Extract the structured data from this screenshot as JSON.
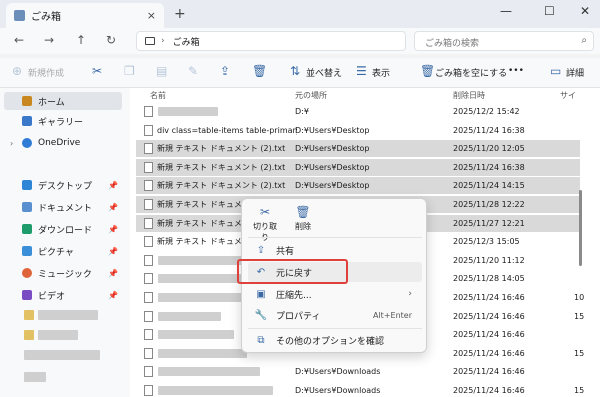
{
  "window": {
    "tab_title": "ごみ箱",
    "close_glyph": "×",
    "new_tab_glyph": "+",
    "minimize_glyph": "—",
    "maximize_glyph": "☐",
    "close_window_glyph": "✕"
  },
  "address": {
    "breadcrumb": "ごみ箱",
    "search_placeholder": "ごみ箱の検索"
  },
  "toolbar": {
    "new_label": "新規作成",
    "sort_label": "並べ替え",
    "view_label": "表示",
    "empty_recycle_label": "ごみ箱を空にする",
    "more_label": "•••",
    "details_label": "詳細"
  },
  "sidebar": {
    "items": [
      {
        "label": "ホーム",
        "icon": "home-icon"
      },
      {
        "label": "ギャラリー",
        "icon": "gallery-icon"
      },
      {
        "label": "OneDrive",
        "icon": "cloud-icon"
      },
      {
        "label": "デスクトップ",
        "icon": "desktop-icon"
      },
      {
        "label": "ドキュメント",
        "icon": "document-icon"
      },
      {
        "label": "ダウンロード",
        "icon": "download-icon"
      },
      {
        "label": "ピクチャ",
        "icon": "picture-icon"
      },
      {
        "label": "ミュージック",
        "icon": "music-icon"
      },
      {
        "label": "ビデオ",
        "icon": "video-icon"
      }
    ],
    "pin_glyph": "📌"
  },
  "columns": {
    "name": "名前",
    "location": "元の場所",
    "deleted_date": "削除日時",
    "size": "サイ"
  },
  "rows": [
    {
      "name": "",
      "location": "D:¥",
      "date": "2025/12/2 15:42",
      "selected": false
    },
    {
      "name": "div class=table-items table-primary...",
      "location": "D:¥Users¥Desktop",
      "date": "2025/11/24 16:38",
      "selected": false
    },
    {
      "name": "新規 テキスト ドキュメント (2).txt",
      "location": "D:¥Users¥Desktop",
      "date": "2025/11/20 12:05",
      "selected": true
    },
    {
      "name": "新規 テキスト ドキュメント (2).txt",
      "location": "D:¥Users¥Desktop",
      "date": "2025/11/24 16:38",
      "selected": true
    },
    {
      "name": "新規 テキスト ドキュメント (2).txt",
      "location": "D:¥Users¥Desktop",
      "date": "2025/11/24 14:15",
      "selected": true
    },
    {
      "name": "新規 テキスト ドキュメント (2",
      "location": "",
      "date": "2025/11/28 12:22",
      "selected": true
    },
    {
      "name": "新規 テキスト ドキュメント.tx",
      "location": "",
      "date": "2025/11/27 12:21",
      "selected": true
    },
    {
      "name": "新規 テキスト ドキュメント.tx",
      "location": "",
      "date": "2025/12/3 15:05",
      "selected": false
    },
    {
      "name": "",
      "location": "",
      "date": "2025/11/20 11:12",
      "selected": false
    },
    {
      "name": "",
      "location": "",
      "date": "2025/11/28 14:05",
      "selected": false
    },
    {
      "name": "",
      "location": "",
      "date": "2025/11/24 16:46",
      "selected": false
    },
    {
      "name": "",
      "location": "",
      "date": "2025/11/24 16:46",
      "selected": false
    },
    {
      "name": "",
      "location": "",
      "date": "2025/11/24 16:46",
      "selected": false
    },
    {
      "name": "",
      "location": "",
      "date": "2025/11/24 16:46",
      "selected": false
    },
    {
      "name": "",
      "location": "D:¥Users¥Downloads",
      "date": "2025/11/24 16:46",
      "selected": false
    },
    {
      "name": "",
      "location": "D:¥Users¥Downloads",
      "date": "2025/11/24 16:46",
      "selected": false
    }
  ],
  "size_values": [
    "10",
    "15",
    "15",
    "15"
  ],
  "context_menu": {
    "cut_label": "切り取り",
    "delete_label": "削除",
    "share_label": "共有",
    "restore_label": "元に戻す",
    "compress_label": "圧縮先...",
    "properties_label": "プロパティ",
    "properties_shortcut": "Alt+Enter",
    "more_options_label": "その他のオプションを確認"
  },
  "colors": {
    "highlight_box": "#e0403a",
    "accent": "#3a6aa5"
  }
}
